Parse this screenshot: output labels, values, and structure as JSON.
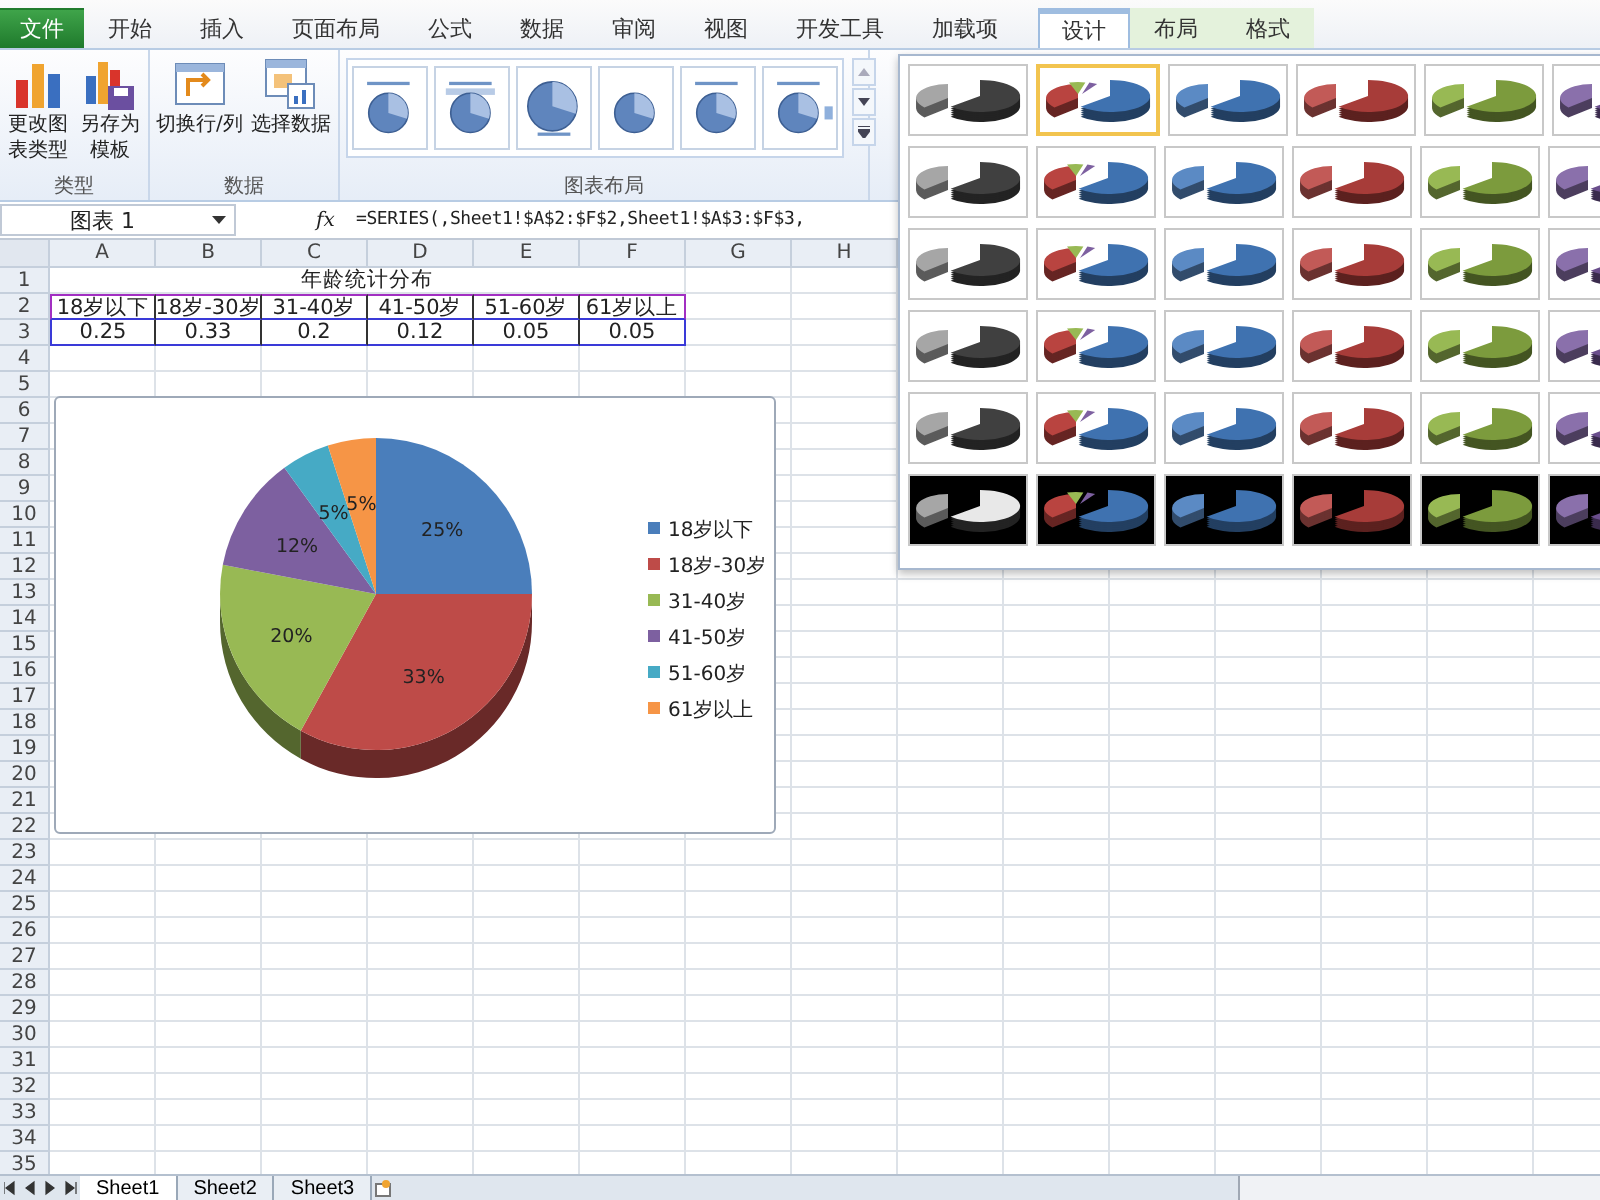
{
  "ribbon_tabs": [
    {
      "label": "文件",
      "kind": "file",
      "selected": false
    },
    {
      "label": "开始",
      "kind": "main",
      "selected": false
    },
    {
      "label": "插入",
      "kind": "main",
      "selected": false
    },
    {
      "label": "页面布局",
      "kind": "main",
      "selected": false
    },
    {
      "label": "公式",
      "kind": "main",
      "selected": false
    },
    {
      "label": "数据",
      "kind": "main",
      "selected": false
    },
    {
      "label": "审阅",
      "kind": "main",
      "selected": false
    },
    {
      "label": "视图",
      "kind": "main",
      "selected": false
    },
    {
      "label": "开发工具",
      "kind": "main",
      "selected": false
    },
    {
      "label": "加载项",
      "kind": "main",
      "selected": false
    },
    {
      "label": "设计",
      "kind": "context",
      "selected": true
    },
    {
      "label": "布局",
      "kind": "context",
      "selected": false
    },
    {
      "label": "格式",
      "kind": "context",
      "selected": false
    }
  ],
  "ribbon_groups": [
    {
      "label": "类型",
      "kind": "buttons",
      "buttons": [
        {
          "label": "更改图表类型",
          "kind": "change"
        },
        {
          "label": "另存为模板",
          "kind": "template"
        }
      ]
    },
    {
      "label": "数据",
      "kind": "buttons",
      "buttons": [
        {
          "label": "切换行/列",
          "kind": "switch"
        },
        {
          "label": "选择数据",
          "kind": "select"
        }
      ]
    },
    {
      "label": "图表布局",
      "kind": "layouts"
    }
  ],
  "formula_bar": {
    "name_box": "图表 1",
    "function_label": "fx",
    "formula": "=SERIES(,Sheet1!$A$2:$F$2,Sheet1!$A$3:$F$3,"
  },
  "sheet": {
    "columns": [
      "A",
      "B",
      "C",
      "D",
      "E",
      "F",
      "G",
      "H"
    ],
    "rows": [
      "1",
      "2",
      "3",
      "4",
      "5",
      "6",
      "7",
      "8",
      "9",
      "10",
      "11",
      "12",
      "13",
      "14",
      "15",
      "16",
      "17",
      "18",
      "19",
      "20",
      "21",
      "22",
      "23",
      "24",
      "25",
      "26",
      "27",
      "28",
      "29",
      "30",
      "31",
      "32",
      "33",
      "34",
      "35"
    ],
    "title": "年龄统计分布",
    "headers": [
      "18岁以下",
      "18岁-30岁",
      "31-40岁",
      "41-50岁",
      "51-60岁",
      "61岁以上"
    ],
    "values": [
      "0.25",
      "0.33",
      "0.2",
      "0.12",
      "0.05",
      "0.05"
    ]
  },
  "chart": {
    "chart_data": {
      "type": "pie",
      "categories": [
        "18岁以下",
        "18岁-30岁",
        "31-40岁",
        "41-50岁",
        "51-60岁",
        "61岁以上"
      ],
      "values": [
        0.25,
        0.33,
        0.2,
        0.12,
        0.05,
        0.05
      ],
      "value_labels": [
        "25%",
        "33%",
        "20%",
        "12%",
        "5%",
        "5%"
      ],
      "legend": "right"
    }
  },
  "style_gallery": {
    "rows": [
      {
        "kind": "light",
        "items": [
          {
            "selected": false
          },
          {
            "selected": true
          },
          {
            "selected": false
          },
          {
            "selected": false
          },
          {
            "selected": false
          },
          {
            "selected": false
          }
        ]
      },
      {
        "kind": "light",
        "items": [
          {
            "selected": false
          },
          {
            "selected": false
          },
          {
            "selected": false
          },
          {
            "selected": false
          },
          {
            "selected": false
          },
          {
            "selected": false
          }
        ]
      },
      {
        "kind": "light",
        "items": [
          {
            "selected": false
          },
          {
            "selected": false
          },
          {
            "selected": false
          },
          {
            "selected": false
          },
          {
            "selected": false
          },
          {
            "selected": false
          }
        ]
      },
      {
        "kind": "light",
        "items": [
          {
            "selected": false
          },
          {
            "selected": false
          },
          {
            "selected": false
          },
          {
            "selected": false
          },
          {
            "selected": false
          },
          {
            "selected": false
          }
        ]
      },
      {
        "kind": "light",
        "items": [
          {
            "selected": false
          },
          {
            "selected": false
          },
          {
            "selected": false
          },
          {
            "selected": false
          },
          {
            "selected": false
          },
          {
            "selected": false
          }
        ]
      },
      {
        "kind": "dark",
        "items": [
          {
            "selected": false
          },
          {
            "selected": false
          },
          {
            "selected": false
          },
          {
            "selected": false
          },
          {
            "selected": false
          },
          {
            "selected": false
          }
        ]
      }
    ]
  },
  "sheet_tabs": [
    {
      "label": "Sheet1",
      "selected": true
    },
    {
      "label": "Sheet2",
      "selected": false
    },
    {
      "label": "Sheet3",
      "selected": false
    }
  ]
}
